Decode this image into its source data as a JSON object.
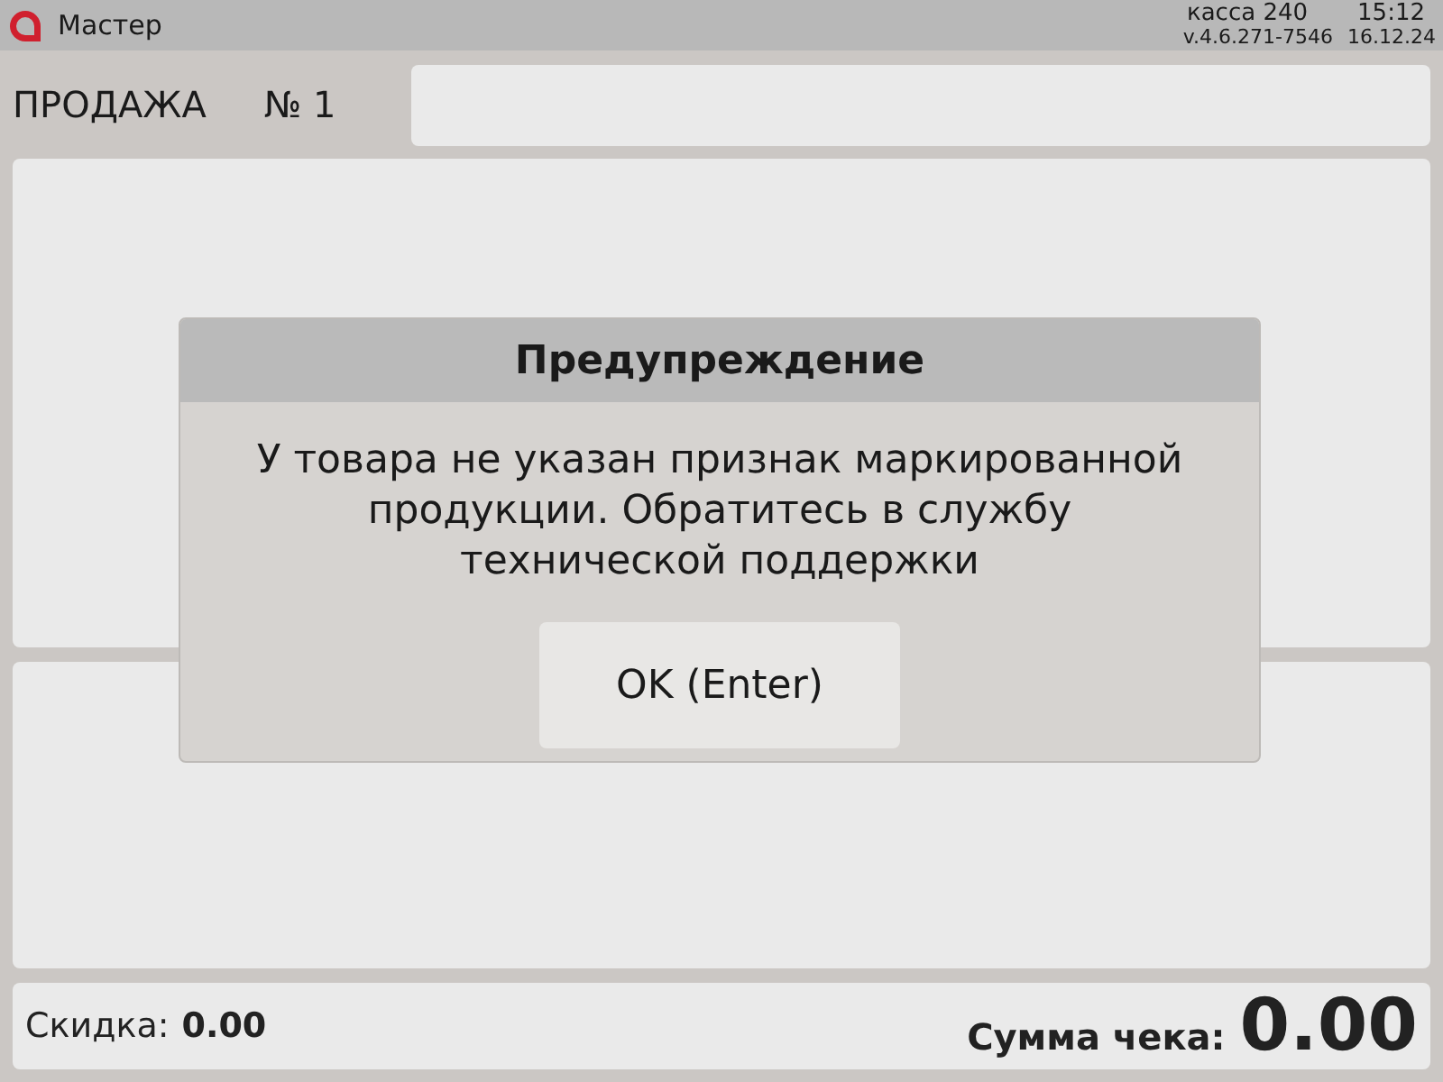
{
  "top_bar": {
    "title": "Мастер",
    "register": "касса 240",
    "time": "15:12",
    "version": "v.4.6.271-7546",
    "date": "16.12.24"
  },
  "header": {
    "title": "ПРОДАЖА",
    "number": "№ 1"
  },
  "dialog": {
    "title": "Предупреждение",
    "message": "У товара не указан признак маркированной продукции. Обратитесь в службу технической поддержки",
    "button": "OK (Enter)"
  },
  "footer": {
    "discount_label": "Скидка:",
    "discount": "0.00",
    "total_label": "Сумма чека:",
    "total": "0.00"
  }
}
